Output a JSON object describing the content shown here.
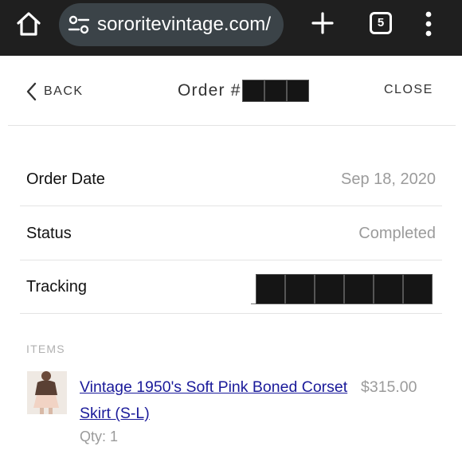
{
  "browser": {
    "url": "sororitevintage.com/",
    "tab_count": "5",
    "icons": [
      "home-icon",
      "site-settings-icon",
      "new-tab-icon",
      "tab-switcher-icon",
      "more-menu-icon"
    ]
  },
  "header": {
    "back_label": "BACK",
    "title": "Order #",
    "close_label": "CLOSE"
  },
  "order": {
    "rows": [
      {
        "label": "Order Date",
        "value": "Sep 18, 2020"
      },
      {
        "label": "Status",
        "value": "Completed"
      },
      {
        "label": "Tracking",
        "value": ""
      }
    ]
  },
  "items": {
    "heading": "ITEMS",
    "list": [
      {
        "name": "Vintage 1950's Soft Pink Boned Corset Skirt (S-L)",
        "price": "$315.00",
        "qty": "Qty: 1"
      }
    ]
  },
  "colors": {
    "chrome_bg": "#1f1f1f",
    "url_pill": "#3b4348",
    "link": "#1a1a9a",
    "muted": "#9b9b9b",
    "rule": "#e4e4e4"
  }
}
